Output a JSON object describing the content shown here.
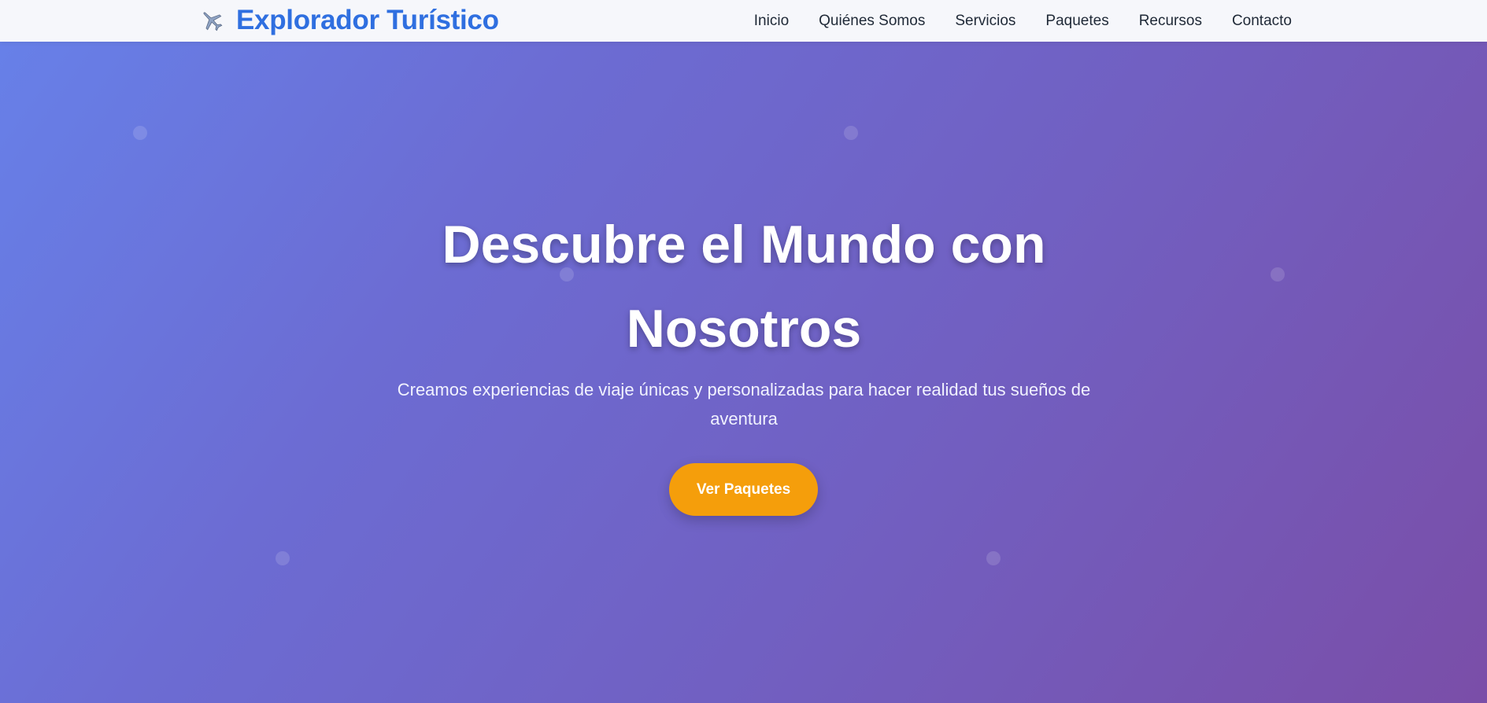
{
  "brand": {
    "name": "Explorador Turístico",
    "icon": "airplane-icon"
  },
  "nav": {
    "items": [
      {
        "label": "Inicio"
      },
      {
        "label": "Quiénes Somos"
      },
      {
        "label": "Servicios"
      },
      {
        "label": "Paquetes"
      },
      {
        "label": "Recursos"
      },
      {
        "label": "Contacto"
      }
    ]
  },
  "hero": {
    "title": "Descubre el Mundo con Nosotros",
    "subtitle": "Creamos experiencias de viaje únicas y personalizadas para hacer realidad tus sueños de aventura",
    "cta_label": "Ver Paquetes"
  },
  "colors": {
    "brand": "#2f6fe0",
    "cta": "#f59e0b",
    "gradient_start": "#6780e8",
    "gradient_end": "#7a4ea8"
  }
}
